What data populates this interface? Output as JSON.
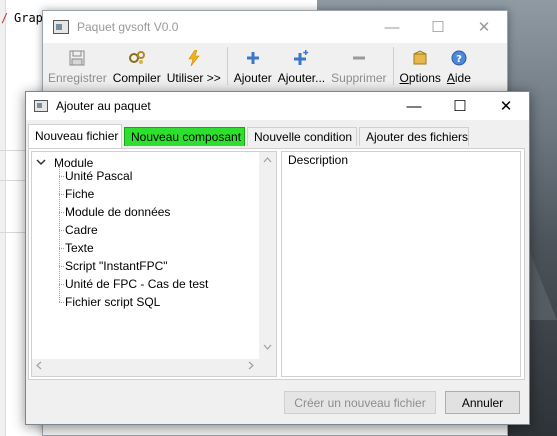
{
  "background": {
    "editor_text": "Grap",
    "editor_mark": "/"
  },
  "main_window": {
    "title": "Paquet gvsoft V0.0",
    "controls": {
      "minimize": "—",
      "maximize": "☐",
      "close": "✕"
    },
    "toolbar": [
      {
        "label": "Enregistrer",
        "icon": "save-icon",
        "enabled": false
      },
      {
        "label": "Compiler",
        "icon": "compile-icon",
        "enabled": true
      },
      {
        "label": "Utiliser >>",
        "icon": "lightning-icon",
        "enabled": true
      },
      {
        "label": "Ajouter",
        "icon": "plus-icon",
        "enabled": true
      },
      {
        "label": "Ajouter...",
        "icon": "plus-more-icon",
        "enabled": true
      },
      {
        "label": "Supprimer",
        "icon": "minus-icon",
        "enabled": false
      },
      {
        "label": "Options",
        "icon": "options-icon",
        "enabled": true
      },
      {
        "label": "Aide",
        "icon": "help-icon",
        "enabled": true
      }
    ]
  },
  "dialog": {
    "title": "Ajouter au paquet",
    "controls": {
      "minimize": "—",
      "maximize": "☐",
      "close": "✕"
    },
    "tabs": [
      {
        "label": "Nouveau fichier",
        "active": true
      },
      {
        "label": "Nouveau composant",
        "active": false,
        "highlight": true
      },
      {
        "label": "Nouvelle condition",
        "active": false
      },
      {
        "label": "Ajouter des fichiers",
        "active": false
      }
    ],
    "tree": {
      "root": "Module",
      "items": [
        "Unité Pascal",
        "Fiche",
        "Module de données",
        "Cadre",
        "Texte",
        "Script \"InstantFPC\"",
        "Unité de FPC - Cas de test",
        "Fichier script SQL"
      ]
    },
    "description_label": "Description",
    "buttons": {
      "create": "Créer un nouveau fichier",
      "cancel": "Annuler"
    }
  },
  "colors": {
    "highlight_tab": "#2ee02e",
    "window_bg": "#f0f0f0",
    "disabled_text": "#8d8d8d"
  }
}
